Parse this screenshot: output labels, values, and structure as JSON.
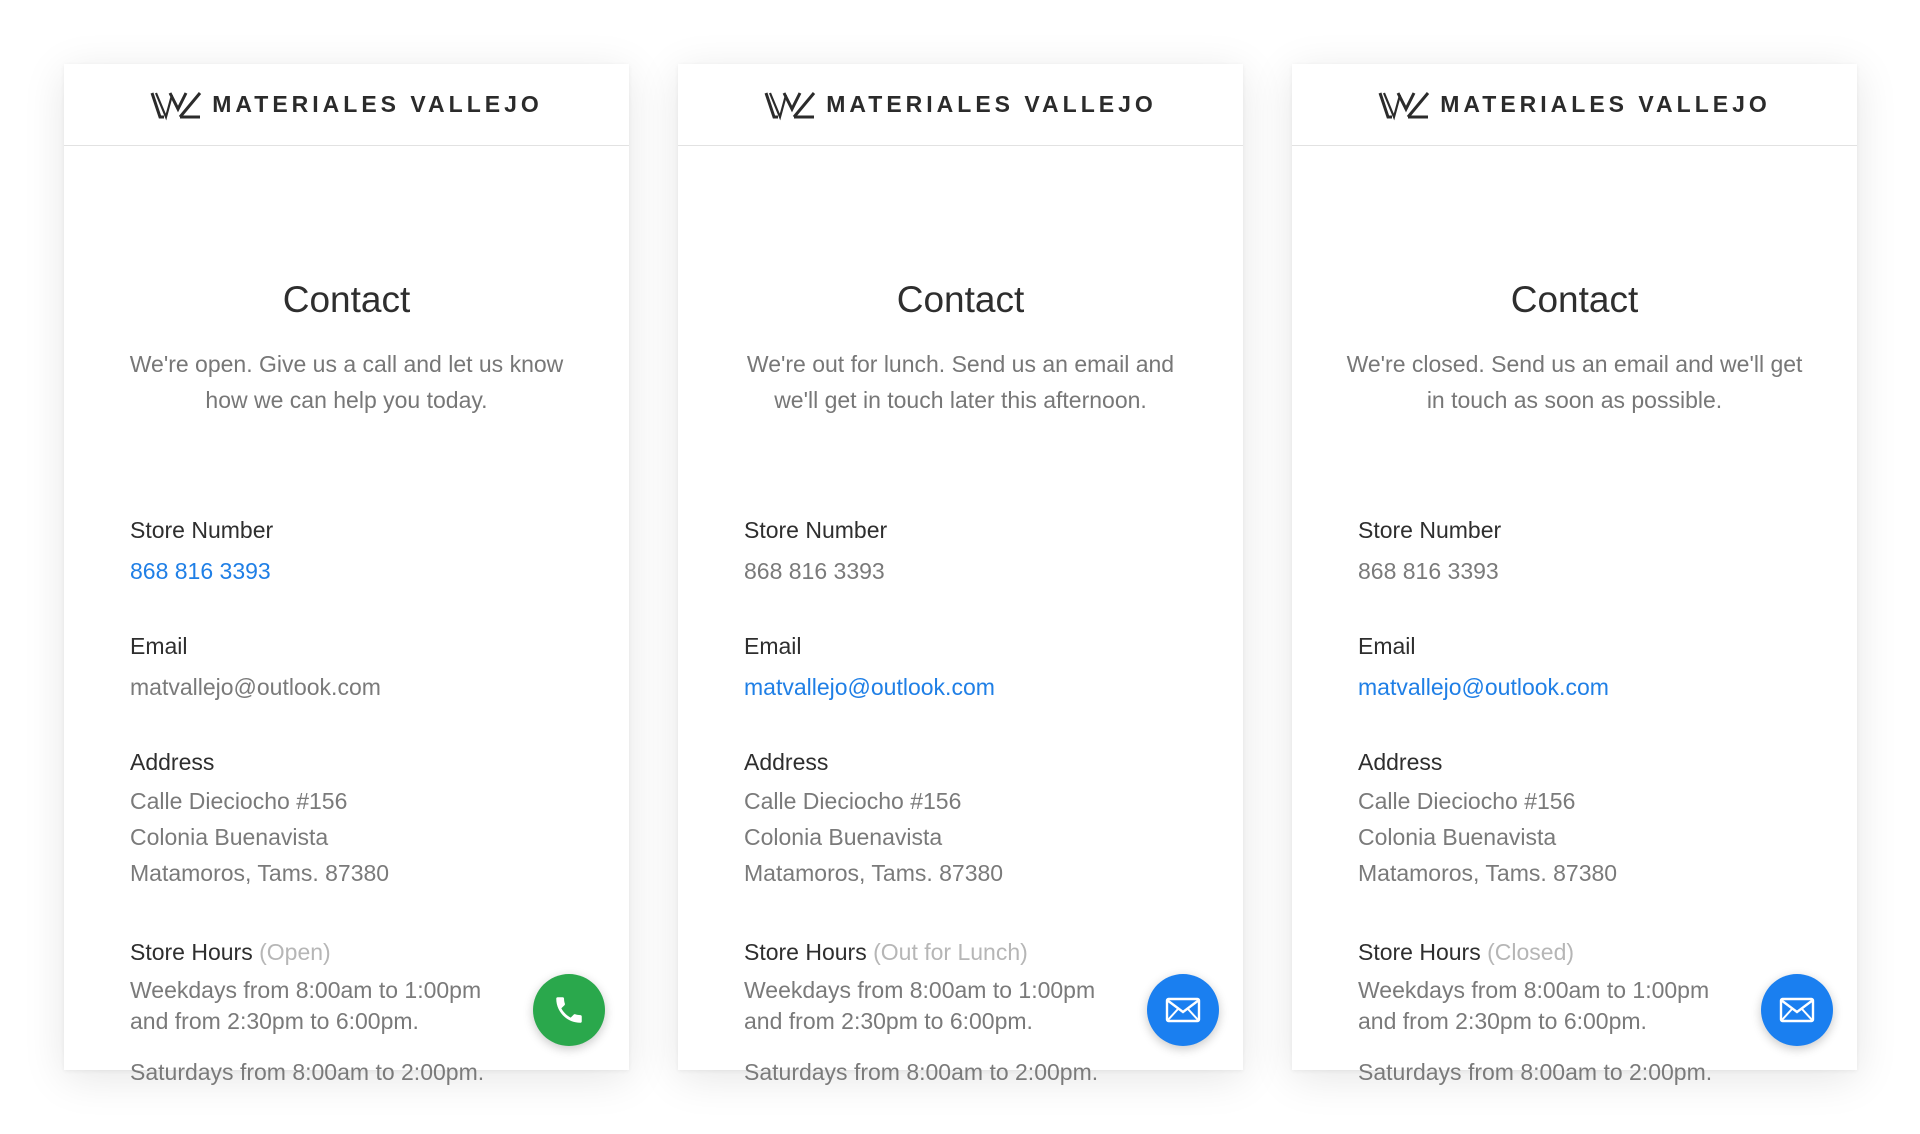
{
  "brand": {
    "name": "MATERIALES VALLEJO"
  },
  "cards": [
    {
      "title": "Contact",
      "subtitle": "We're open. Give us a call and let us know how we can help you today.",
      "phone_label": "Store Number",
      "phone_value": "868 816 3393",
      "email_label": "Email",
      "email_value": "matvallejo@outlook.com",
      "address_label": "Address",
      "address_lines": [
        "Calle Dieciocho #156",
        "Colonia Buenavista",
        "Matamoros, Tams. 87380"
      ],
      "hours_label": "Store Hours",
      "hours_state": "(Open)",
      "hours_weekdays": "Weekdays from 8:00am to 1:00pm and from 2:30pm to 6:00pm.",
      "hours_saturday": "Saturdays from 8:00am to 2:00pm.",
      "fab_icon": "phone-icon",
      "fab_color": "#2aa84c",
      "link_color": "#1f7fe6"
    },
    {
      "title": "Contact",
      "subtitle": "We're out for lunch. Send us an email and we'll get in touch later this afternoon.",
      "phone_label": "Store Number",
      "phone_value": "868 816 3393",
      "email_label": "Email",
      "email_value": "matvallejo@outlook.com",
      "address_label": "Address",
      "address_lines": [
        "Calle Dieciocho #156",
        "Colonia Buenavista",
        "Matamoros, Tams. 87380"
      ],
      "hours_label": "Store Hours",
      "hours_state": "(Out for Lunch)",
      "hours_weekdays": "Weekdays from 8:00am to 1:00pm and from 2:30pm to 6:00pm.",
      "hours_saturday": "Saturdays from 8:00am to 2:00pm.",
      "fab_icon": "mail-icon",
      "fab_color": "#1a7ff0",
      "link_color": "#1f7fe6"
    },
    {
      "title": "Contact",
      "subtitle": "We're closed. Send us an email and we'll get in touch as soon as possible.",
      "phone_label": "Store Number",
      "phone_value": "868 816 3393",
      "email_label": "Email",
      "email_value": "matvallejo@outlook.com",
      "address_label": "Address",
      "address_lines": [
        "Calle Dieciocho #156",
        "Colonia Buenavista",
        "Matamoros, Tams. 87380"
      ],
      "hours_label": "Store Hours",
      "hours_state": "(Closed)",
      "hours_weekdays": "Weekdays from 8:00am to 1:00pm and from 2:30pm to 6:00pm.",
      "hours_saturday": "Saturdays from 8:00am to 2:00pm.",
      "fab_icon": "mail-icon",
      "fab_color": "#1a7ff0",
      "link_color": "#1f7fe6"
    }
  ]
}
